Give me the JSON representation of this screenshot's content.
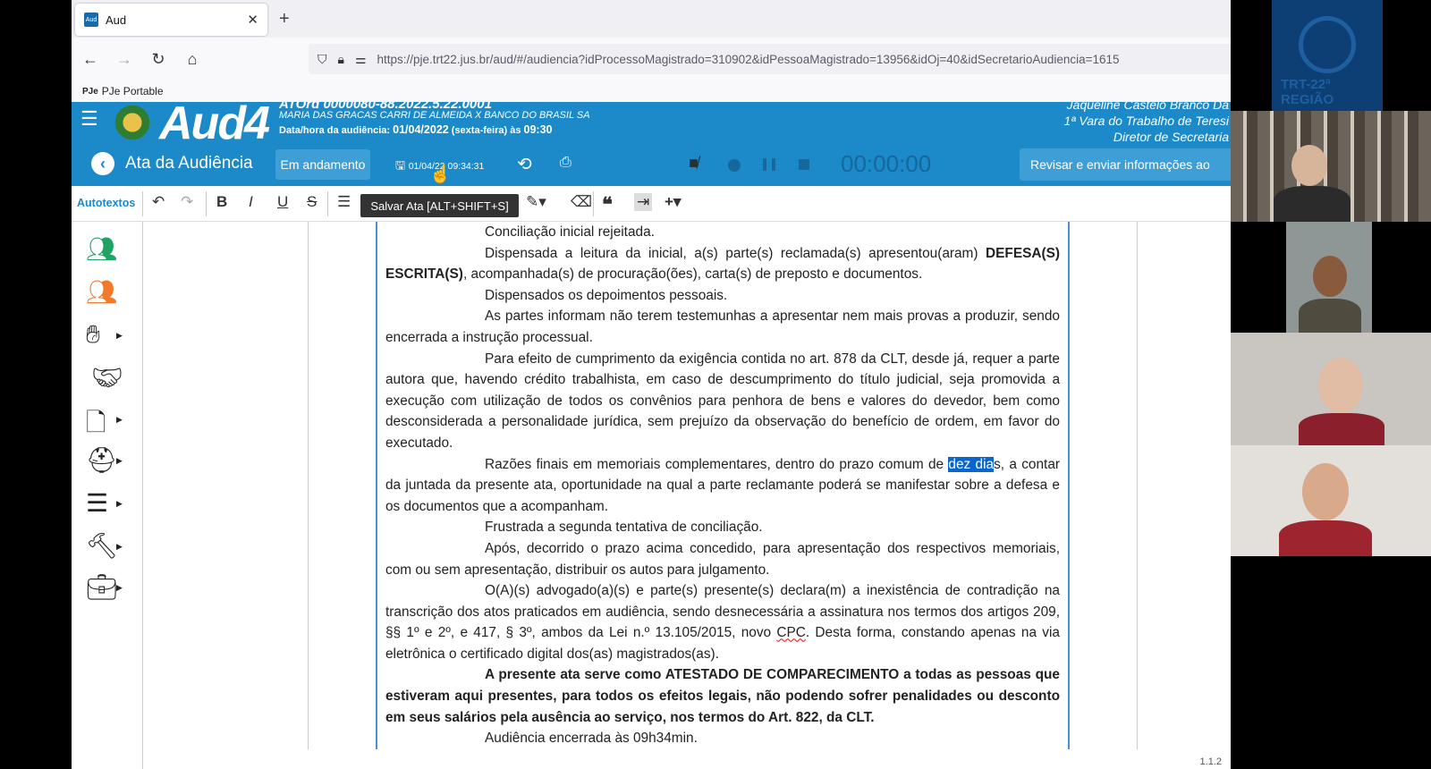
{
  "browser": {
    "tab_title": "Aud",
    "tab_favicon_text": "Aud",
    "new_tab": "+",
    "url": "https://pje.trt22.jus.br/aud/#/audiencia?idProcessoMagistrado=310902&idPessoaMagistrado=13956&idOj=40&idSecretarioAudiencia=1615",
    "bookmark": "PJe Portable",
    "bookmark_icon": "PJe"
  },
  "app": {
    "logo": "Aud4",
    "process_number": "ATOrd 0000080-88.2022.5.22.0001",
    "parties": "MARIA DAS GRACAS CARRI DE ALMEIDA X BANCO DO BRASIL SA",
    "date_label": "Data/hora da audiência:",
    "date_value": "01/04/2022",
    "date_suffix": "(sexta-feira) às",
    "time_value": "09:30",
    "user_name": "Jaqueline Castelo Branco Da",
    "court": "1ª Vara do Trabalho de Teresi",
    "role": "Diretor de Secretaria"
  },
  "toolbar": {
    "title": "Ata da Audiência",
    "status": "Em andamento",
    "saved_at": "01/04/22 09:34:31",
    "timer": "00:00:00",
    "review_button": "Revisar e enviar informações ao",
    "tooltip": "Salvar Ata [ALT+SHIFT+S]"
  },
  "editor": {
    "autotexts": "Autotextos",
    "buttons": [
      "B",
      "I",
      "U",
      "S"
    ]
  },
  "document": {
    "p1": "Conciliação inicial rejeitada.",
    "p2a": "Dispensada a leitura da inicial, a(s) parte(s) reclamada(s) apresentou(aram)",
    "p2b": "DEFESA(S) ESCRITA(S)",
    "p2c": ", acompanhada(s) de procuração(ões), carta(s) de preposto e documentos.",
    "p3": "Dispensados os depoimentos pessoais.",
    "p4": "As partes informam não terem testemunhas a apresentar nem mais provas a produzir, sendo encerrada a instrução processual.",
    "p5": "Para efeito de cumprimento da exigência contida no art. 878 da CLT, desde já, requer a parte autora que, havendo crédito trabalhista, em caso de descumprimento do título judicial, seja promovida a execução com utilização de todos os convênios para penhora de bens e valores do devedor, bem como desconsiderada a personalidade jurídica, sem prejuízo da observação do benefício de ordem, em favor do executado.",
    "p6a": "Razões finais em memoriais complementares, dentro do prazo comum de ",
    "p6hl": "dez dia",
    "p6b": "s, a contar da juntada da presente ata, oportunidade na qual a parte reclamante poderá se manifestar sobre a defesa e os documentos que a acompanham.",
    "p7": "Frustrada a segunda tentativa de conciliação.",
    "p8": "Após, decorrido o prazo acima concedido, para apresentação dos respectivos memoriais, com ou sem apresentação, distribuir os autos para julgamento.",
    "p9a": "O(A)(s) advogado(a)(s) e parte(s) presente(s) declara(m) a inexistência de contradição na transcrição dos atos praticados em audiência, sendo desnecessária a assinatura nos termos dos artigos 209, §§ 1º e 2º, e 417, § 3º, ambos da Lei n.º 13.105/2015, novo ",
    "p9cpc": "CPC",
    "p9b": ". Desta forma, constando apenas na via eletrônica o certificado digital dos(as) magistrados(as).",
    "p10": "A presente ata serve como ATESTADO DE COMPARECIMENTO a todas as pessoas que estiveram aqui presentes, para todos os efeitos legais, não podendo sofrer penalidades ou desconto em seus salários pela ausência ao serviço, nos termos do Art. 822, da CLT.",
    "p11": "Audiência encerrada às 09h34min."
  },
  "version": "1.1.2",
  "video": {
    "tile1_label": "TRT-22ª REGIÃO"
  },
  "colors": {
    "brand_blue": "#1c89c9",
    "green_icon": "#1ea363",
    "orange_icon": "#f2792b",
    "selection": "#0a66cc"
  }
}
